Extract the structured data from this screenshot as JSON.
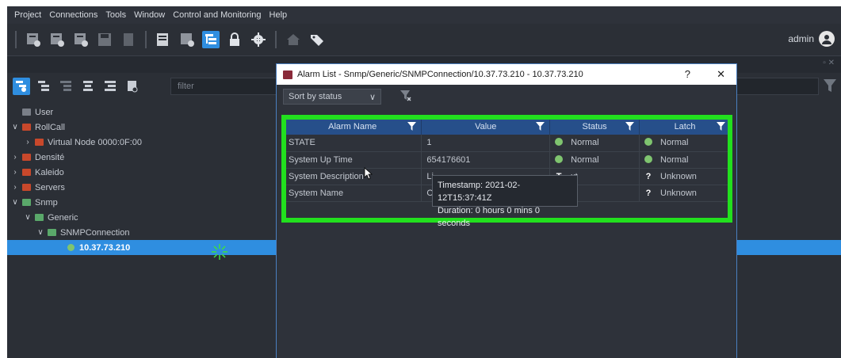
{
  "menu": [
    "Project",
    "Connections",
    "Tools",
    "Window",
    "Control and Monitoring",
    "Help"
  ],
  "toolbar": {
    "icons": [
      "add-device-icon",
      "add-device-2-icon",
      "add-device-3-icon",
      "save-icon",
      "import-icon",
      "layout-icon",
      "layout-add-icon",
      "tree-view-icon",
      "lock-icon",
      "settings-icon",
      "home-icon",
      "tag-icon"
    ],
    "user": "admin"
  },
  "tree_panel": {
    "filter_placeholder": "filter",
    "items": [
      {
        "label": "User",
        "indent": 0,
        "expand": "",
        "folder": "grey"
      },
      {
        "label": "RollCall",
        "indent": 0,
        "expand": "open",
        "folder": "red"
      },
      {
        "label": "Virtual Node 0000:0F:00",
        "indent": 1,
        "expand": "closed",
        "folder": "red"
      },
      {
        "label": "Densité",
        "indent": 0,
        "expand": "closed",
        "folder": "red"
      },
      {
        "label": "Kaleido",
        "indent": 0,
        "expand": "closed",
        "folder": "red"
      },
      {
        "label": "Servers",
        "indent": 0,
        "expand": "closed",
        "folder": "red"
      },
      {
        "label": "Snmp",
        "indent": 0,
        "expand": "open",
        "folder": "green"
      },
      {
        "label": "Generic",
        "indent": 1,
        "expand": "open",
        "folder": "green"
      },
      {
        "label": "SNMPConnection",
        "indent": 2,
        "expand": "open",
        "folder": "green"
      },
      {
        "label": "10.37.73.210",
        "indent": 3,
        "expand": "",
        "folder": "status",
        "selected": true
      }
    ]
  },
  "dialog": {
    "title": "Alarm List - Snmp/Generic/SNMPConnection/10.37.73.210 - 10.37.73.210",
    "help_label": "?",
    "close_label": "✕",
    "sort_label": "Sort by status",
    "columns": [
      "Alarm Name",
      "Value",
      "Status",
      "Latch"
    ],
    "rows": [
      {
        "name": "STATE",
        "value": "1",
        "status": "Normal",
        "status_icon": "green-dot",
        "latch": "Normal",
        "latch_icon": "green-dot"
      },
      {
        "name": "System Up Time",
        "value": "654176601",
        "status": "Normal",
        "status_icon": "green-dot",
        "latch": "Normal",
        "latch_icon": "green-dot"
      },
      {
        "name": "System Description",
        "value": "Li",
        "status": "xt",
        "status_icon": "text",
        "latch": "Unknown",
        "latch_icon": "question"
      },
      {
        "name": "System Name",
        "value": "O",
        "status": "xt",
        "status_icon": "text",
        "latch": "Unknown",
        "latch_icon": "question"
      }
    ],
    "tooltip": {
      "timestamp": "Timestamp: 2021-02-12T15:37:41Z",
      "duration": "Duration: 0 hours 0 mins 0 seconds"
    }
  },
  "colors": {
    "accent": "#2f8ee0",
    "highlight": "#22e01e",
    "normal": "#7fc46f",
    "header": "#264f8a"
  }
}
